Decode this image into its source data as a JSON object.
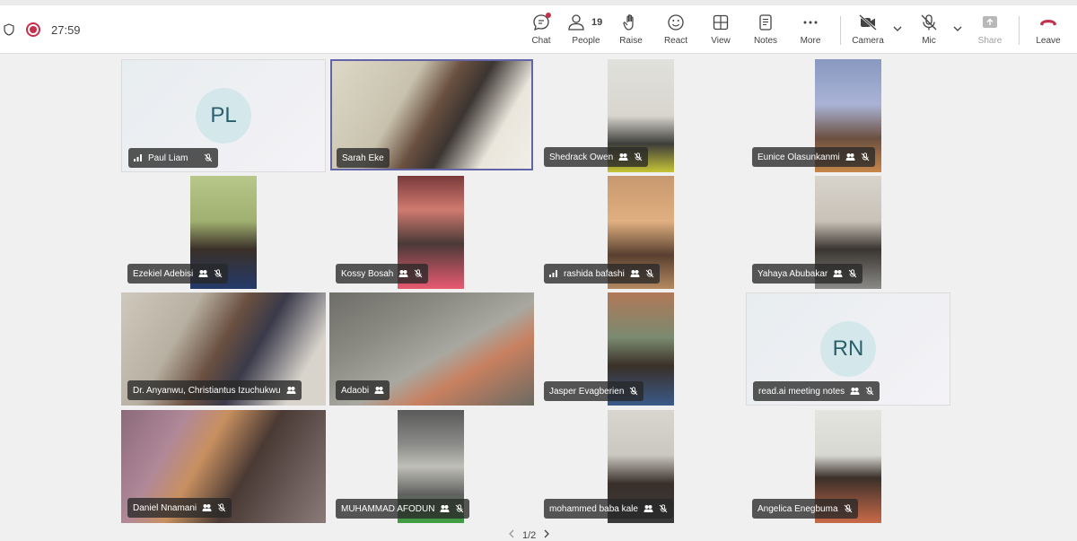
{
  "meeting": {
    "timer": "27:59"
  },
  "toolbar": {
    "chat": "Chat",
    "people": "People",
    "people_count": "19",
    "raise": "Raise",
    "react": "React",
    "view": "View",
    "notes": "Notes",
    "more": "More",
    "camera": "Camera",
    "mic": "Mic",
    "share": "Share",
    "leave": "Leave"
  },
  "participants": [
    {
      "name": "Paul Liam",
      "initials": "PL",
      "signal": true
    },
    {
      "name": "Sarah Eke"
    },
    {
      "name": "Shedrack Owen"
    },
    {
      "name": "Eunice Olasunkanmi"
    },
    {
      "name": "Ezekiel Adebisi"
    },
    {
      "name": "Kossy Bosah"
    },
    {
      "name": "rashida bafashi",
      "signal": true
    },
    {
      "name": "Yahaya Abubakar"
    },
    {
      "name": "Dr. Anyanwu, Christiantus Izuchukwu"
    },
    {
      "name": "Adaobi"
    },
    {
      "name": "Jasper Evagberien"
    },
    {
      "name": "read.ai meeting notes",
      "initials": "RN"
    },
    {
      "name": "Daniel Nnamani"
    },
    {
      "name": "MUHAMMAD AFODUN"
    },
    {
      "name": "mohammed baba kale"
    },
    {
      "name": "Angelica Enegbuma"
    }
  ],
  "pager": {
    "label": "1/2"
  },
  "colors": {
    "accent": "#6264a7",
    "leave": "#c4314b",
    "recording": "#c4314b"
  }
}
